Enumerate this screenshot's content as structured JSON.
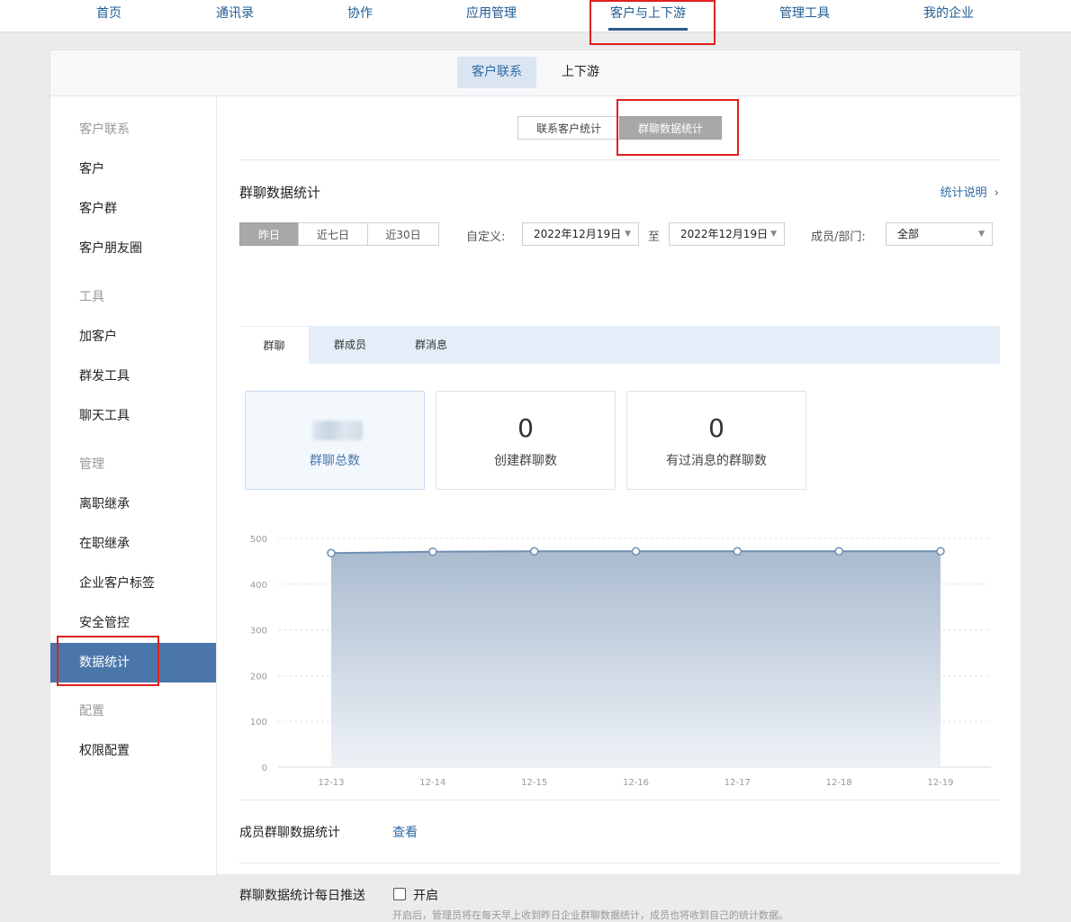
{
  "topnav": {
    "items": [
      "首页",
      "通讯录",
      "协作",
      "应用管理",
      "客户与上下游",
      "管理工具",
      "我的企业"
    ],
    "active": "客户与上下游"
  },
  "subnav": {
    "tabs": [
      "客户联系",
      "上下游"
    ],
    "active": "客户联系"
  },
  "sidebar": {
    "items": [
      {
        "label": "客户联系",
        "type": "group"
      },
      {
        "label": "客户",
        "type": "item"
      },
      {
        "label": "客户群",
        "type": "item"
      },
      {
        "label": "客户朋友圈",
        "type": "item"
      },
      {
        "label": "工具",
        "type": "group"
      },
      {
        "label": "加客户",
        "type": "item"
      },
      {
        "label": "群发工具",
        "type": "item"
      },
      {
        "label": "聊天工具",
        "type": "item"
      },
      {
        "label": "管理",
        "type": "group"
      },
      {
        "label": "离职继承",
        "type": "item"
      },
      {
        "label": "在职继承",
        "type": "item"
      },
      {
        "label": "企业客户标签",
        "type": "item"
      },
      {
        "label": "安全管控",
        "type": "item"
      },
      {
        "label": "数据统计",
        "type": "item",
        "active": true
      },
      {
        "label": "配置",
        "type": "group"
      },
      {
        "label": "权限配置",
        "type": "item"
      }
    ]
  },
  "segment": {
    "left": "联系客户统计",
    "right": "群聊数据统计",
    "active": "群聊数据统计"
  },
  "section": {
    "title": "群聊数据统计",
    "explain": "统计说明",
    "explain_icon": "chevron-right-icon"
  },
  "filters": {
    "ranges": [
      "昨日",
      "近七日",
      "近30日"
    ],
    "active_range": "昨日",
    "custom_label": "自定义:",
    "start_date": "2022年12月19日",
    "to": "至",
    "end_date": "2022年12月19日",
    "member_label": "成员/部门:",
    "member_value": "全部"
  },
  "tabs": {
    "items": [
      "群聊",
      "群成员",
      "群消息"
    ],
    "active": "群聊"
  },
  "stats": [
    {
      "value": "",
      "label": "群聊总数",
      "active": true,
      "blurred": true
    },
    {
      "value": "0",
      "label": "创建群聊数"
    },
    {
      "value": "0",
      "label": "有过消息的群聊数"
    }
  ],
  "chart_data": {
    "type": "area",
    "x": [
      "12-13",
      "12-14",
      "12-15",
      "12-16",
      "12-17",
      "12-18",
      "12-19"
    ],
    "values": [
      468,
      471,
      472,
      472,
      472,
      472,
      472
    ],
    "yticks": [
      0,
      100,
      200,
      300,
      400,
      500
    ],
    "ylim": [
      0,
      500
    ],
    "grid": true,
    "line_color": "#6f8eb3",
    "fill_top": "#aabbcf",
    "fill_bottom": "#eef2f7"
  },
  "footer": {
    "member_stats_label": "成员群聊数据统计",
    "view_link": "查看",
    "daily_push_label": "群聊数据统计每日推送",
    "enable_label": "开启",
    "enable_checked": false,
    "note": "开启后，管理员将在每天早上收到昨日企业群聊数据统计，成员也将收到自己的统计数据。"
  },
  "colors": {
    "accent": "#4a76aa",
    "link": "#2f6aa5",
    "highlight_box": "#e02020"
  }
}
